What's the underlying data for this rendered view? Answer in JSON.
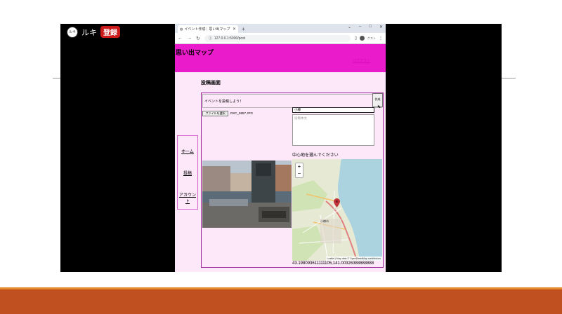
{
  "channel": {
    "name": "ルキ",
    "subscribe_label": "登録",
    "avatar_text": "ルキ"
  },
  "browser": {
    "tab_title": "イベント作成｜思い出マップ",
    "new_tab": "+",
    "url": "127.0.0.1:5000/post",
    "profile_label": "ゲスト",
    "window_controls": [
      "⌄",
      "–",
      "□",
      "✕"
    ]
  },
  "site": {
    "title": "思い出マップ",
    "logout_label": "ログアウト"
  },
  "page": {
    "heading": "投稿画面",
    "nav": [
      "ホーム",
      "投稿",
      "アカウント"
    ],
    "form": {
      "title_value": "イベントを投稿しよう！",
      "submit_label": "作成",
      "file_button_label": "ファイルを選択",
      "file_name": "DSC_5857.JPG",
      "place_value": "小樽",
      "description_placeholder": "投稿本文",
      "map_prompt": "中心地を選んでください",
      "map_zoom_in": "+",
      "map_zoom_out": "−",
      "map_attribution": "Leaflet | Map data © OpenStreetMap contributors",
      "map_city_label": "小樽市",
      "coordinates": "43.198093611111105,141.00326388888888"
    }
  },
  "colors": {
    "header": "#ea1bcb",
    "page_bg": "#fde8fa",
    "border": "#a0229a",
    "slide_band": "#c0501f"
  },
  "icons": {
    "tab": "globe-icon",
    "back": "back-arrow-icon",
    "forward": "forward-arrow-icon",
    "reload": "reload-icon",
    "map_marker": "map-pin-icon"
  }
}
